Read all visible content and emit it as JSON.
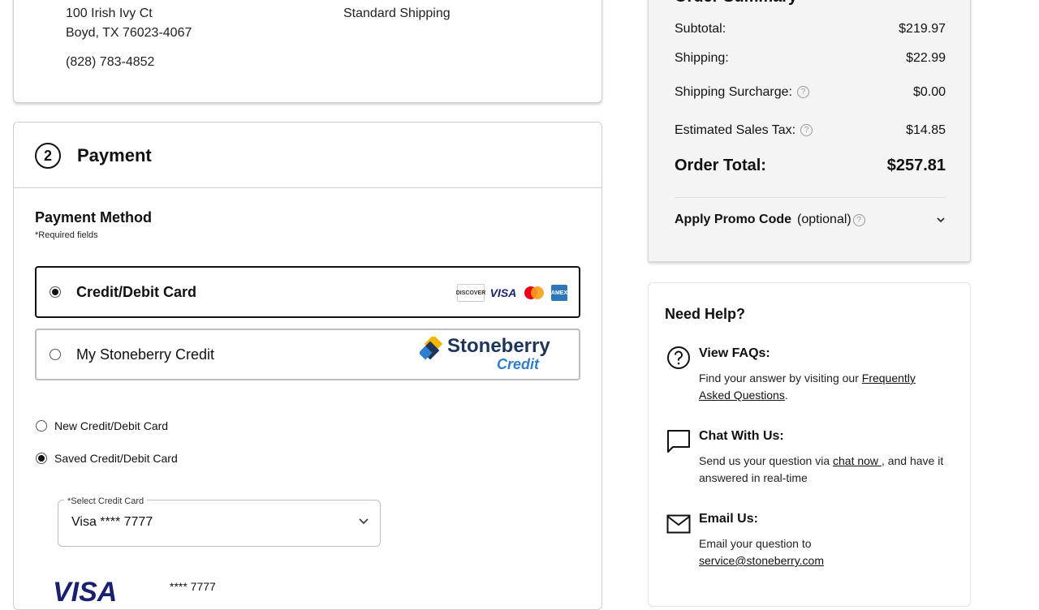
{
  "shipping": {
    "address_line1": "100 Irish Ivy Ct",
    "address_line2": "Boyd, TX 76023-4067",
    "phone": "(828) 783-4852",
    "method": "Standard Shipping"
  },
  "payment": {
    "step_number": "2",
    "title": "Payment",
    "method_heading": "Payment Method",
    "required_note": "*Required fields",
    "options": [
      {
        "label": "Credit/Debit Card",
        "selected": true
      },
      {
        "label": "My Stoneberry Credit",
        "selected": false
      }
    ],
    "card_logos": [
      "DISCOVER",
      "VISA",
      "mastercard",
      "AMEX"
    ],
    "stoneberry_logo": {
      "brand": "Stoneberry",
      "sub": "Credit"
    },
    "card_choice": [
      {
        "label": "New Credit/Debit Card",
        "selected": false
      },
      {
        "label": "Saved Credit/Debit Card",
        "selected": true
      }
    ],
    "select": {
      "label": "*Select Credit Card",
      "value": "Visa **** 7777"
    },
    "saved_card_brand": "VISA",
    "saved_card_masked": "**** 7777"
  },
  "summary": {
    "title": "Order Summary",
    "rows": [
      {
        "label": "Subtotal:",
        "value": "$219.97"
      },
      {
        "label": "Shipping:",
        "value": "$22.99"
      },
      {
        "label": "Shipping Surcharge:",
        "value": "$0.00"
      },
      {
        "label": "Estimated Sales Tax:",
        "value": "$14.85"
      }
    ],
    "total_label": "Order Total:",
    "total_value": "$257.81",
    "promo_label": "Apply Promo Code",
    "promo_optional": "(optional)"
  },
  "help": {
    "title": "Need Help?",
    "faq_title": "View FAQs:",
    "faq_text": "Find your answer by visiting our ",
    "faq_link": "Frequently Asked Questions",
    "faq_end": ".",
    "chat_title": "Chat With Us:",
    "chat_text": "Send us your question via ",
    "chat_link": "chat now ",
    "chat_end": ", and have it answered in real-time",
    "email_title": "Email Us:",
    "email_text": "Email your question to",
    "email_link": "service@stoneberry.com"
  },
  "colors": {
    "stoneberry_navy": "#1c3558",
    "stoneberry_blue": "#2e7fd0",
    "visa_blue": "#1a1f71"
  }
}
